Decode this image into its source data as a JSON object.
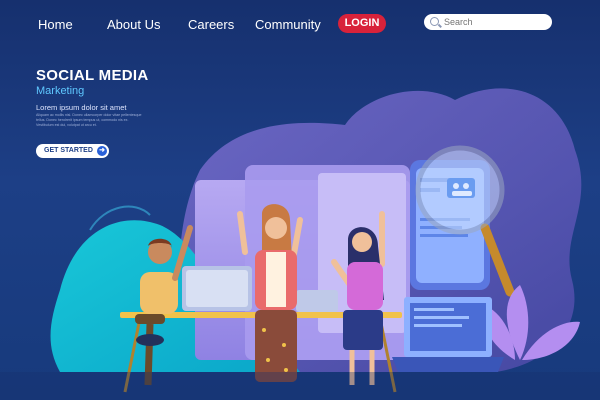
{
  "nav": {
    "items": [
      "Home",
      "About Us",
      "Careers",
      "Community"
    ],
    "login_label": "LOGIN",
    "search_placeholder": "Search"
  },
  "hero": {
    "title": "SOCIAL MEDIA",
    "subtitle": "Marketing",
    "lorem": "Lorem ipsum dolor sit amet",
    "body": "Aliquam ac mollis nisl. Donec ullamcorper dolor vitae pellentesque tellus. Donec hendrerit ipsum tempus ut, commodo nis ex. Vestibulum est dui, volutpat ut arcu et.",
    "cta_label": "GET STARTED"
  },
  "colors": {
    "background": "#1d3f86",
    "login": "#d8223a",
    "accent": "#5fc8ff",
    "cta_arrow": "#2860d8"
  }
}
